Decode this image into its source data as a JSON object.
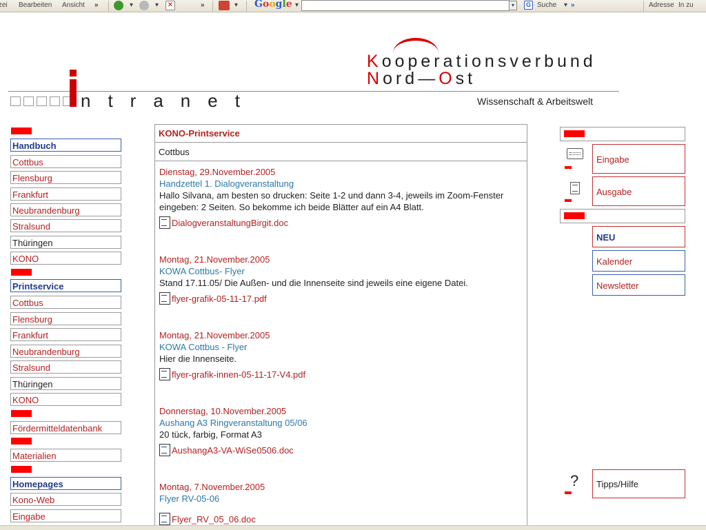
{
  "browser": {
    "menu": [
      "zei",
      "Bearbeiten",
      "Ansicht"
    ],
    "google_label": "Google",
    "search_label": "Suche",
    "address_label": "Adresse",
    "go_label": "In zu",
    "search_value": ""
  },
  "header": {
    "title_line1_first": "K",
    "title_line1_rest": "ooperationsverbund",
    "title_line2_first": "N",
    "title_line2_mid": "ord—",
    "title_line2_o": "O",
    "title_line2_rest": "st",
    "intranet_i": "i",
    "intranet": "ntranet",
    "tagline": "Wissenschaft & Arbeitswelt"
  },
  "left_nav": {
    "groups": [
      {
        "heading": "Handbuch",
        "items": [
          "Cottbus",
          "Flensburg",
          "Frankfurt",
          "Neubrandenburg",
          "Stralsund",
          "Thüringen",
          "KONO"
        ]
      },
      {
        "heading": "Printservice",
        "items": [
          "Cottbus",
          "Flensburg",
          "Frankfurt",
          "Neubrandenburg",
          "Stralsund",
          "Thüringen",
          "KONO"
        ]
      },
      {
        "heading": "",
        "items": [
          "Fördermitteldatenbank"
        ]
      },
      {
        "heading": "",
        "items": [
          "Materialien"
        ]
      },
      {
        "heading": "Homepages",
        "items": [
          "Kono-Web",
          "Eingabe"
        ]
      }
    ]
  },
  "main": {
    "title": "KONO-Printservice",
    "city": "Cottbus",
    "entries": [
      {
        "date": "Dienstag, 29.November.2005",
        "title": "Handzettel 1. Dialogveranstaltung",
        "text": "Hallo Silvana, am besten so drucken: Seite 1-2 und dann 3-4, jeweils im Zoom-Fenster eingeben: 2 Seiten. So bekomme ich beide Blätter auf ein A4 Blatt.",
        "file": "DialogveranstaltungBirgit.doc"
      },
      {
        "date": "Montag, 21.November.2005",
        "title": "KOWA Cottbus- Flyer",
        "text": "Stand 17.11.05/ Die Außen- und die Innenseite sind jeweils eine eigene Datei.",
        "file": "flyer-grafik-05-11-17.pdf"
      },
      {
        "date": "Montag, 21.November.2005",
        "title": "KOWA Cottbus - Flyer",
        "text": "Hier die Innenseite.",
        "file": "flyer-grafik-innen-05-11-17-V4.pdf"
      },
      {
        "date": "Donnerstag, 10.November.2005",
        "title": "Aushang A3 Ringveranstaltung 05/06",
        "text": "20 tück, farbig, Format A3",
        "file": "AushangA3-VA-WiSe0506.doc"
      },
      {
        "date": "Montag, 7.November.2005",
        "title": "Flyer RV-05-06",
        "text": "",
        "file": "Flyer_RV_05_06.doc"
      }
    ]
  },
  "right_panel": {
    "eingabe": "Eingabe",
    "ausgabe": "Ausgabe",
    "neu": "NEU",
    "kalender": "Kalender",
    "newsletter": "Newsletter",
    "hilfe": "Tipps/Hilfe",
    "help_glyph": "?"
  },
  "colors": {
    "accent_red": "#d40000",
    "link_red": "#b52020",
    "link_blue": "#2a78a8",
    "heading_blue": "#1f3c8a"
  }
}
